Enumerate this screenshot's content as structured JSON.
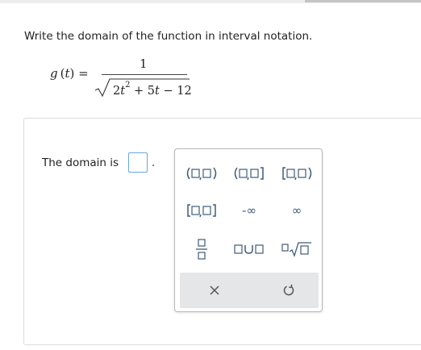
{
  "question": {
    "instruction": "Write the domain of the function in interval notation."
  },
  "formula": {
    "lhs_name": "g",
    "lhs_var": "t",
    "equals": "=",
    "numerator": "1",
    "den_coef": "2",
    "den_var1": "t",
    "den_exp": "2",
    "den_mid": " + 5",
    "den_var2": "t",
    "den_tail": " − 12"
  },
  "answer": {
    "label": "The domain is",
    "value": "",
    "period": "."
  },
  "palette": {
    "buttons": [
      "open interval",
      "left-closed right-open interval",
      "closed interval",
      "left-open right-closed interval",
      "negative infinity",
      "infinity",
      "fraction",
      "union",
      "nth root"
    ],
    "neg_infinity_label": "-∞",
    "infinity_label": "∞",
    "actions": [
      "clear",
      "undo"
    ]
  }
}
